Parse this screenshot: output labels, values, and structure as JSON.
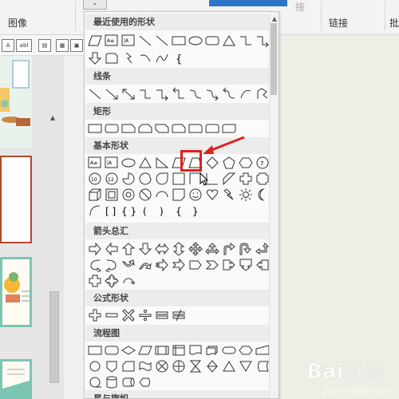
{
  "ribbon": {
    "image_group_label": "图像",
    "link_group_label": "链接",
    "insert_label": "接",
    "cut_label": "批",
    "dropdown_toggle": "⌄"
  },
  "toolbar": {
    "text_icon_label": "abl"
  },
  "dropdown": {
    "sections": [
      {
        "title": "最近使用的形状"
      },
      {
        "title": "线条"
      },
      {
        "title": "矩形"
      },
      {
        "title": "基本形状"
      },
      {
        "title": "箭头总汇"
      },
      {
        "title": "公式形状"
      },
      {
        "title": "流程图"
      },
      {
        "title": "星与旗帜"
      }
    ]
  },
  "annotation": {
    "highlight_color": "#e02020",
    "arrow_color": "#e02020"
  },
  "watermark": {
    "text": "Baidu 经验",
    "url": "jingyan.baidu.com"
  }
}
